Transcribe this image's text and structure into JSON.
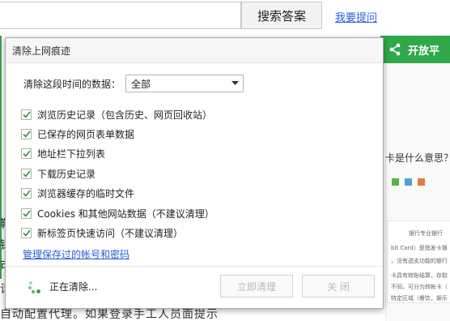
{
  "background": {
    "search_button": "搜索答案",
    "ask_link": "我要提问",
    "green_bar_label": "开放平",
    "right_question": "卡是什么意思？",
    "thumb_lines": [
      "银行专业银行",
      "bit Card）是指发卡银",
      "，没有透支功能的银行",
      "卡具有转账结算，存取",
      "不同，可分为转帐卡（",
      "特定区域（餐饮，娱乐"
    ],
    "left_chars": [
      "鞋",
      "钱",
      "可",
      "请"
    ],
    "bottom_text": "自动配置代理。如果登录手工人员面提示"
  },
  "dialog": {
    "title": "清除上网痕迹",
    "range_label": "清除这段时间的数据：",
    "range_value": "全部",
    "options": [
      {
        "label": "浏览历史记录（包含历史、网页回收站）",
        "checked": true
      },
      {
        "label": "已保存的网页表单数据",
        "checked": true
      },
      {
        "label": "地址栏下拉列表",
        "checked": true
      },
      {
        "label": "下载历史记录",
        "checked": true
      },
      {
        "label": "浏览器缓存的临时文件",
        "checked": true
      },
      {
        "label": "Cookies 和其他网站数据（不建议清理）",
        "checked": true
      },
      {
        "label": "新标签页快速访问（不建议清理）",
        "checked": true
      }
    ],
    "manage_link": "管理保存过的帐号和密码",
    "status": "正在清除...",
    "clear_button": "立即清理",
    "close_button": "关 闭"
  },
  "colors": {
    "accent_green": "#2fa84a",
    "link_blue": "#2b5bd8"
  }
}
